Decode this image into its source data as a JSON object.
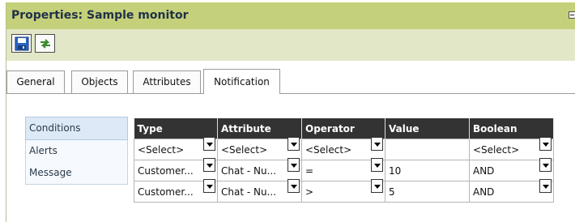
{
  "window": {
    "title": "Properties: Sample monitor"
  },
  "tabs": [
    "General",
    "Objects",
    "Attributes",
    "Notification"
  ],
  "active_tab": "Notification",
  "side_menu": [
    "Conditions",
    "Alerts",
    "Message"
  ],
  "table": {
    "headers": [
      "Type",
      "Attribute",
      "Operator",
      "Value",
      "Boolean"
    ],
    "rows": [
      [
        "<Select>",
        "<Select>",
        "<Select>",
        "",
        "<Select>"
      ],
      [
        "Customer...",
        "Chat - Nu...",
        "=",
        "10",
        "AND"
      ],
      [
        "Customer...",
        "Chat - Nu...",
        ">",
        "5",
        "AND"
      ]
    ]
  },
  "colors": {
    "title_bar": "#c5d07a",
    "toolbar": "#e2e8c7",
    "table_header": "#333333",
    "side_selected": "#dde9f6"
  },
  "icons": {
    "save": "floppy-disk-icon",
    "refresh": "refresh-arrows-icon",
    "minimize": "minimize-icon"
  }
}
